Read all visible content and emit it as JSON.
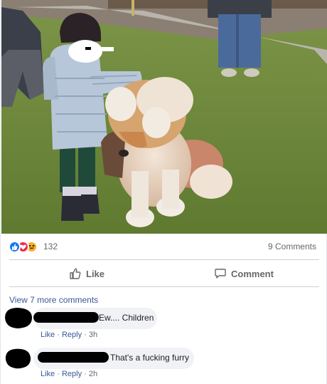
{
  "post": {
    "photo": {
      "description_icon": "photo-image"
    },
    "reactions": {
      "icons": [
        "like-icon",
        "love-icon",
        "haha-icon"
      ],
      "count": "132",
      "comments_count": "9 Comments"
    },
    "actions": {
      "like_label": "Like",
      "comment_label": "Comment"
    },
    "view_more": "View 7 more comments",
    "comments": [
      {
        "text": "Ew.... Children",
        "like": "Like",
        "sep1": " · ",
        "reply": "Reply",
        "sep2": " · ",
        "time": "3h"
      },
      {
        "text": "That's a fucking furry",
        "like": "Like",
        "sep1": " · ",
        "reply": "Reply",
        "sep2": " · ",
        "time": "2h"
      }
    ]
  },
  "colors": {
    "fb_blue": "#1877f2",
    "link_blue": "#385898",
    "grey_text": "#65676b",
    "bubble_bg": "#f0f2f5"
  }
}
